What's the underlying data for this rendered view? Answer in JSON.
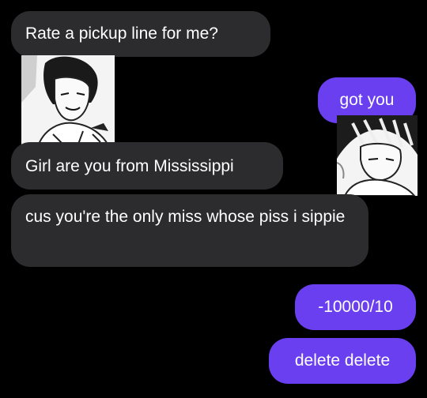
{
  "messages": [
    {
      "side": "received",
      "text": "Rate a pickup line for me?"
    },
    {
      "side": "sent",
      "text": "got you"
    },
    {
      "side": "received",
      "text": "Girl are you from Mississippi"
    },
    {
      "side": "received",
      "text": "cus you're the only miss whose piss i sippie"
    },
    {
      "side": "sent",
      "text": "-10000/10"
    },
    {
      "side": "sent",
      "text": "delete delete"
    }
  ],
  "avatars": [
    {
      "side": "received",
      "icon": "manga-character-avatar-dark-hair"
    },
    {
      "side": "sent",
      "icon": "manga-character-avatar-striped-hair"
    }
  ],
  "colors": {
    "background": "#000000",
    "received_bubble": "#2c2c2e",
    "sent_bubble": "#6a3ff0",
    "text": "#ffffff"
  }
}
